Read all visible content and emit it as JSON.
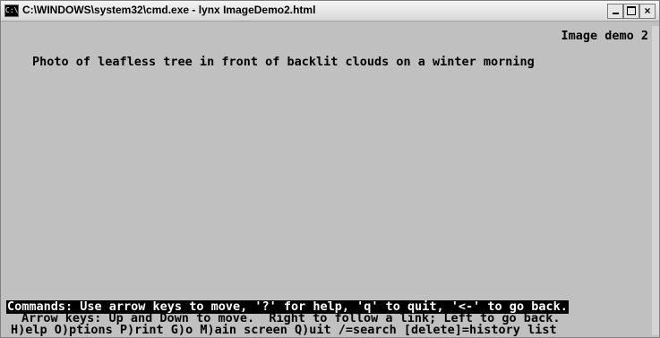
{
  "window": {
    "title": "C:\\WINDOWS\\system32\\cmd.exe - lynx ImageDemo2.html",
    "buttons": {
      "minimize": "_",
      "maximize": "□",
      "close": "×"
    }
  },
  "page": {
    "title": "Image demo 2",
    "image_alt": "Photo of leafless tree in front of backlit clouds on a winter morning"
  },
  "statusbar": {
    "commands": "Commands: Use arrow keys to move, '?' for help, 'q' to quit, '<-' to go back.",
    "arrow_help": "Arrow keys: Up and Down to move.  Right to follow a link; Left to go back.",
    "menu_help": "H)elp O)ptions P)rint G)o M)ain screen Q)uit /=search [delete]=history list"
  }
}
